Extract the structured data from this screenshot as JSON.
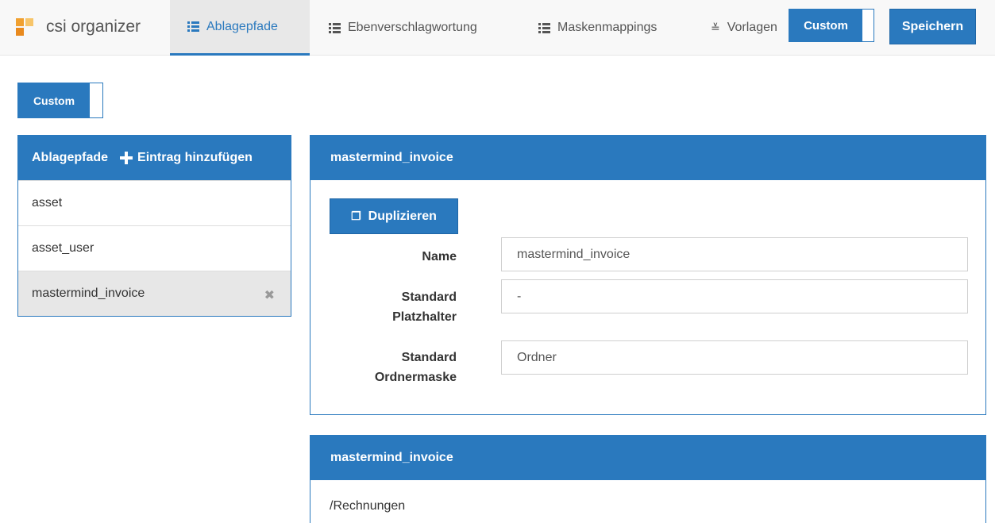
{
  "app": {
    "name": "csi organizer"
  },
  "nav": {
    "tabs": [
      {
        "label": "Ablagepfade",
        "icon": "list-icon",
        "active": true
      },
      {
        "label": "Ebenverschlagwortung",
        "icon": "list-icon",
        "active": false
      },
      {
        "label": "Maskenmappings",
        "icon": "list-icon",
        "active": false
      },
      {
        "label": "Vorlagen",
        "icon": "template-icon",
        "active": false
      }
    ],
    "custom_toggle_label": "Custom",
    "save_label": "Speichern"
  },
  "page": {
    "custom_toggle_label": "Custom"
  },
  "left_panel": {
    "title": "Ablagepfade",
    "add_label": "Eintrag hinzufügen",
    "items": [
      {
        "label": "asset"
      },
      {
        "label": "asset_user"
      },
      {
        "label": "mastermind_invoice",
        "selected": true
      }
    ]
  },
  "detail": {
    "title": "mastermind_invoice",
    "duplicate_label": "Duplizieren",
    "fields": {
      "name": {
        "label": "Name",
        "value": "mastermind_invoice"
      },
      "placeholder": {
        "label_line1": "Standard",
        "label_line2": "Platzhalter",
        "value": "-"
      },
      "folder_mask": {
        "label_line1": "Standard",
        "label_line2": "Ordnermaske",
        "value": "Ordner"
      }
    }
  },
  "second_card": {
    "title": "mastermind_invoice",
    "path": "/Rechnungen"
  },
  "colors": {
    "primary": "#2a79be",
    "brand_orange": "#f0a030",
    "navbar_bg": "#f8f8f8",
    "selected_row": "#e7e7e7"
  }
}
